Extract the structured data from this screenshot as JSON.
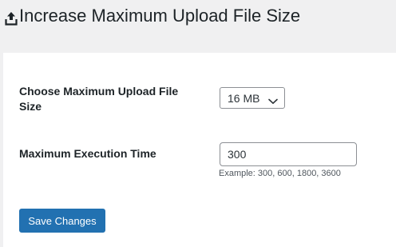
{
  "page": {
    "title": "Increase Maximum Upload File Size",
    "title_icon": "upload-icon"
  },
  "form": {
    "upload_size": {
      "label": "Choose Maximum Upload File Size",
      "selected": "16 MB",
      "dropdown_icon": "chevron-down-icon"
    },
    "execution_time": {
      "label": "Maximum Execution Time",
      "value": "300",
      "hint": "Example: 300, 600, 1800, 3600"
    },
    "save_label": "Save Changes"
  },
  "colors": {
    "background": "#f0f0f1",
    "panel": "#ffffff",
    "primary_button": "#2271b1",
    "text": "#1d2327"
  }
}
